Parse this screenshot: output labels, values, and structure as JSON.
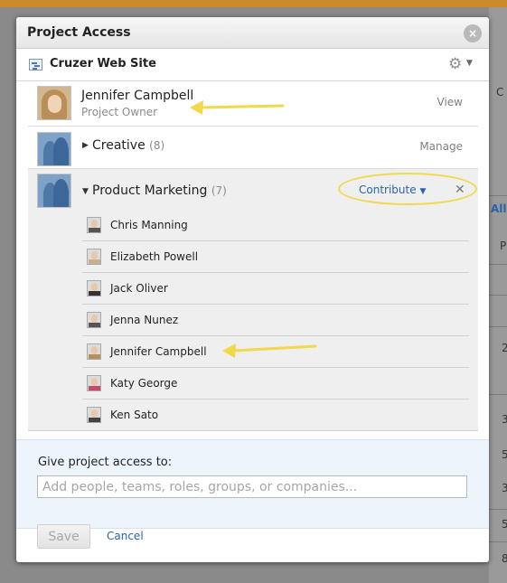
{
  "background": {
    "right_text": [
      "C",
      "All",
      "P",
      "2",
      "3",
      "5",
      "3",
      "5",
      "8"
    ]
  },
  "dialog": {
    "title": "Project Access",
    "close_label": "×",
    "project_name": "Cruzer Web Site"
  },
  "owner": {
    "name": "Jennifer Campbell",
    "role": "Project Owner",
    "permission": "View"
  },
  "teams": [
    {
      "name": "Creative",
      "count": "(8)",
      "permission": "Manage",
      "expanded": false
    },
    {
      "name": "Product Marketing",
      "count": "(7)",
      "permission": "Contribute",
      "expanded": true
    }
  ],
  "members": [
    {
      "name": "Chris Manning"
    },
    {
      "name": "Elizabeth Powell"
    },
    {
      "name": "Jack Oliver"
    },
    {
      "name": "Jenna Nunez"
    },
    {
      "name": "Jennifer Campbell"
    },
    {
      "name": "Katy George"
    },
    {
      "name": "Ken Sato"
    }
  ],
  "give_access": {
    "label": "Give project access to:",
    "placeholder": "Add people, teams, roles, groups, or companies...",
    "value": ""
  },
  "footer": {
    "save_label": "Save",
    "cancel_label": "Cancel"
  },
  "colors": {
    "accent": "#2a63a8",
    "highlight": "#f1d94a",
    "panel": "#eef4fc"
  },
  "icons": {
    "close": "close-icon",
    "gear": "gear-icon",
    "remove": "remove-icon"
  }
}
